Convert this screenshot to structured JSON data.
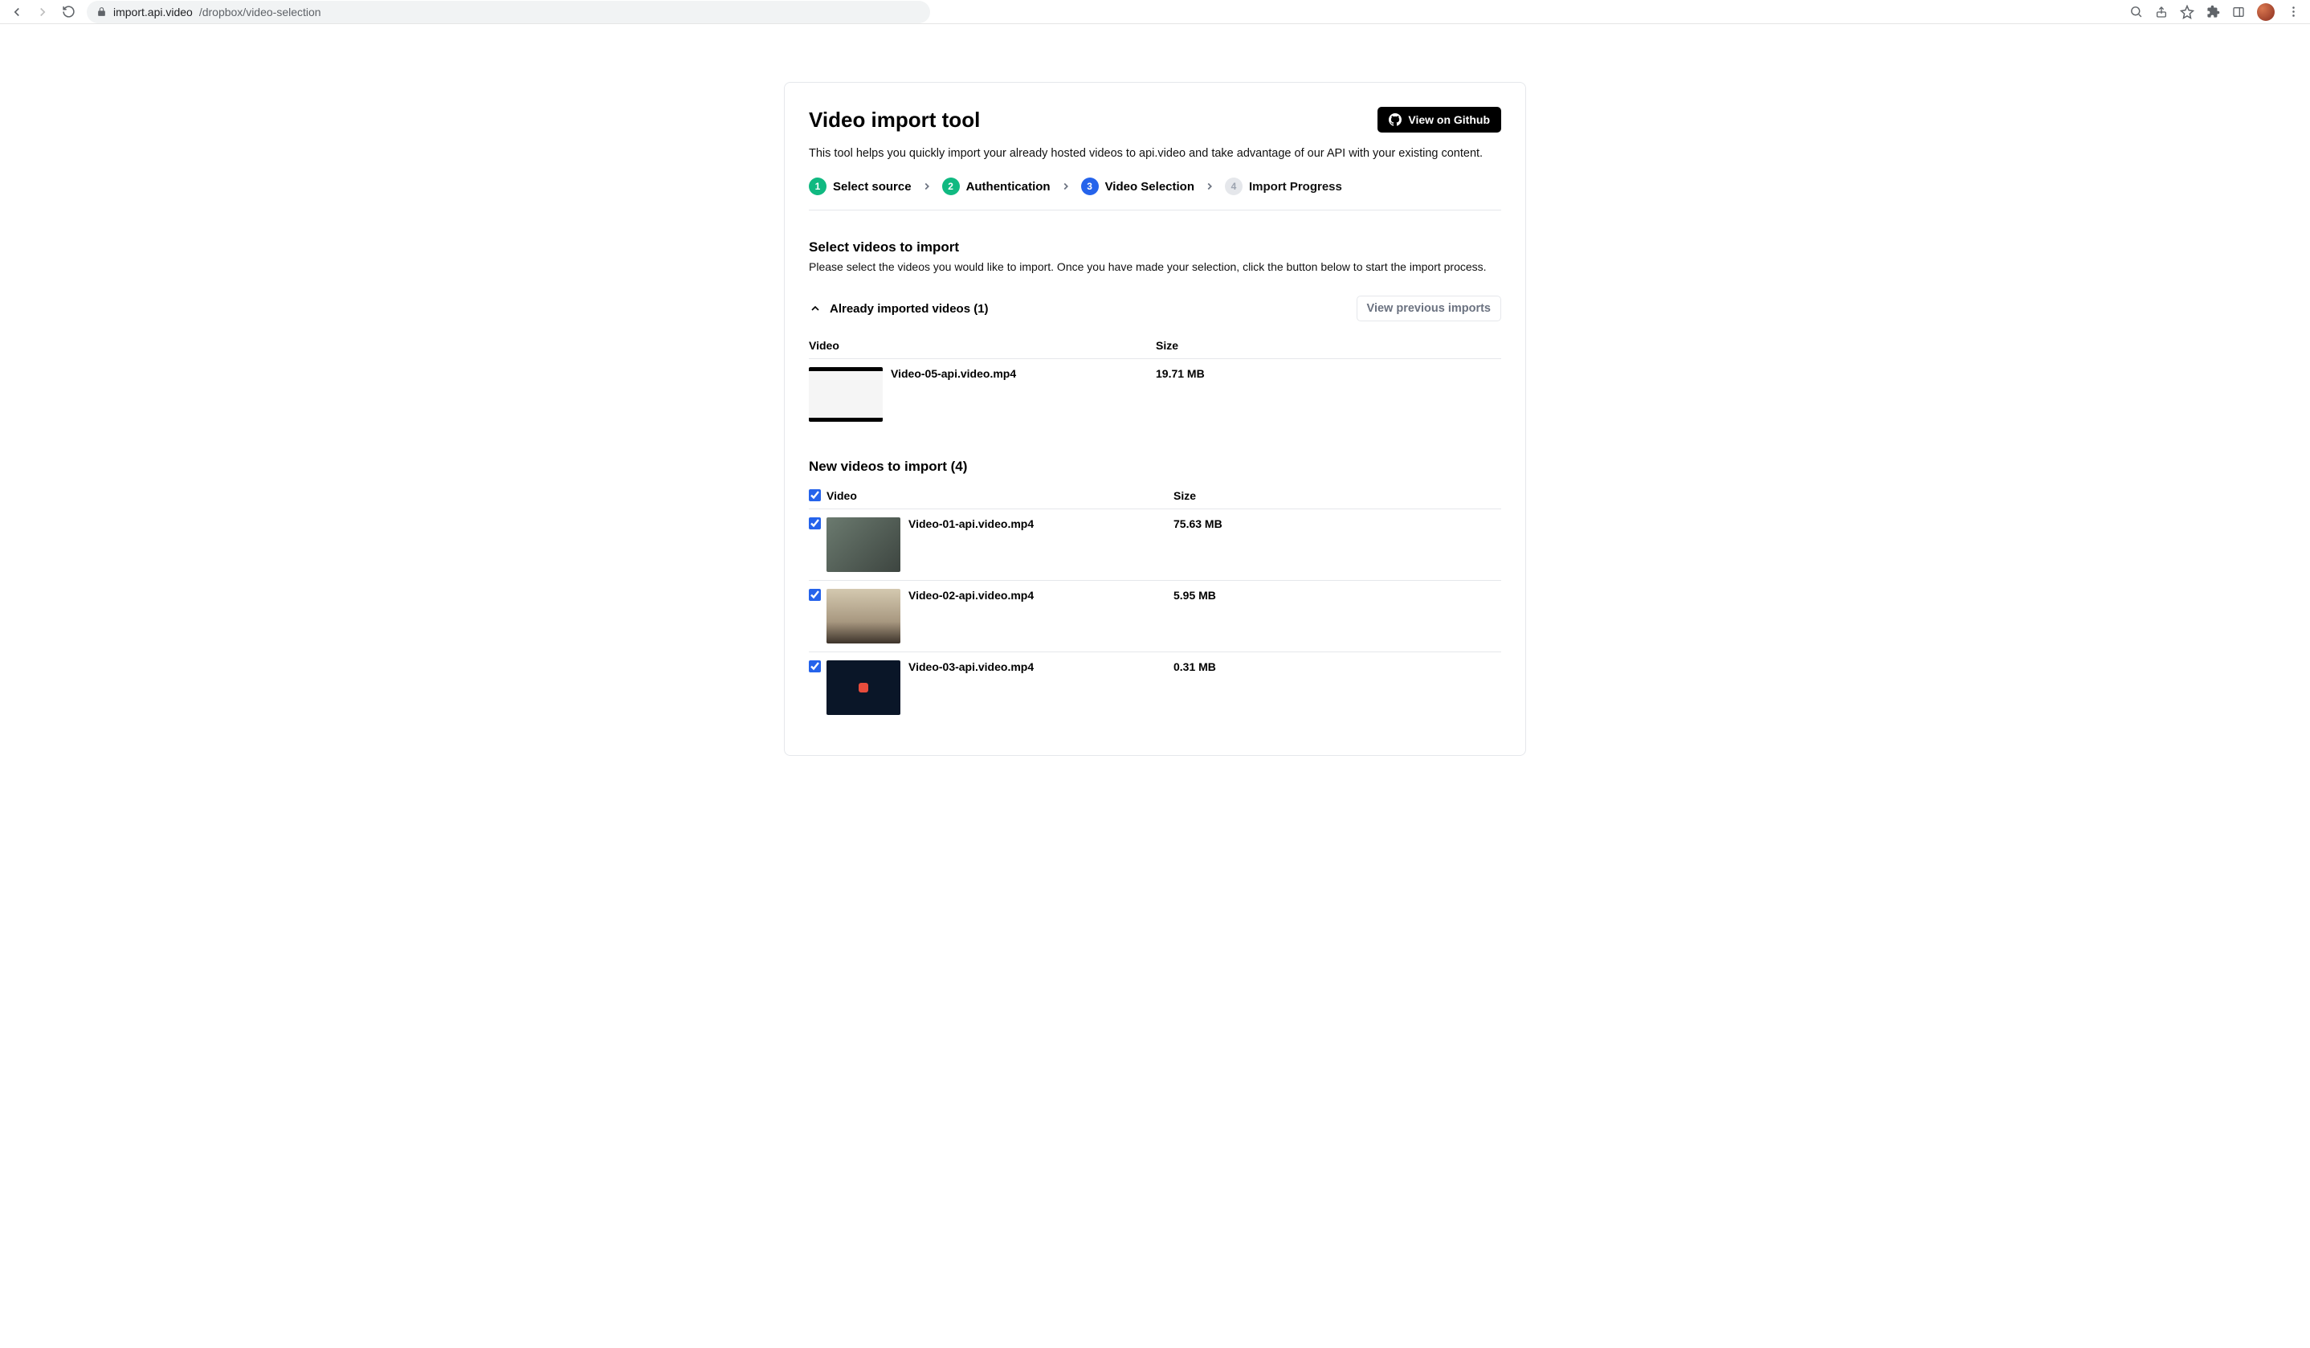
{
  "browser": {
    "url_host": "import.api.video",
    "url_path": "/dropbox/video-selection"
  },
  "header": {
    "title": "Video import tool",
    "github_button": "View on Github",
    "subtitle": "This tool helps you quickly import your already hosted videos to api.video and take advantage of our API with your existing content."
  },
  "steps": [
    {
      "num": "1",
      "label": "Select source",
      "state": "done"
    },
    {
      "num": "2",
      "label": "Authentication",
      "state": "done"
    },
    {
      "num": "3",
      "label": "Video Selection",
      "state": "active"
    },
    {
      "num": "4",
      "label": "Import Progress",
      "state": "pending"
    }
  ],
  "selection": {
    "heading": "Select videos to import",
    "desc": "Please select the videos you would like to import. Once you have made your selection, click the button below to start the import process."
  },
  "already": {
    "toggle_label": "Already imported videos (1)",
    "view_previous": "View previous imports",
    "columns": {
      "video": "Video",
      "size": "Size"
    },
    "rows": [
      {
        "name": "Video-05-api.video.mp4",
        "size": "19.71 MB",
        "thumb": "screencast"
      }
    ]
  },
  "new": {
    "heading": "New videos to import (4)",
    "columns": {
      "video": "Video",
      "size": "Size"
    },
    "rows": [
      {
        "name": "Video-01-api.video.mp4",
        "size": "75.63 MB",
        "checked": true,
        "thumb": "scene1"
      },
      {
        "name": "Video-02-api.video.mp4",
        "size": "5.95 MB",
        "checked": true,
        "thumb": "scene2"
      },
      {
        "name": "Video-03-api.video.mp4",
        "size": "0.31 MB",
        "checked": true,
        "thumb": "scene3"
      }
    ]
  }
}
